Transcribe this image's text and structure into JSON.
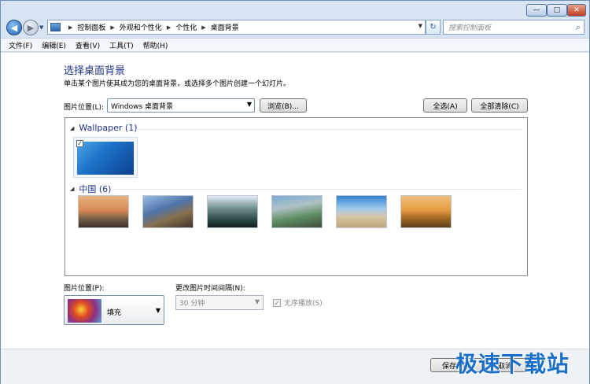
{
  "window": {
    "minimize": "—",
    "maximize": "□",
    "close": "✕"
  },
  "nav": {
    "back_icon": "arrow-left-icon",
    "forward_icon": "arrow-right-icon",
    "breadcrumbs": [
      "控制面板",
      "外观和个性化",
      "个性化",
      "桌面背景"
    ],
    "search_placeholder": "搜索控制面板"
  },
  "menu": [
    "文件(F)",
    "编辑(E)",
    "查看(V)",
    "工具(T)",
    "帮助(H)"
  ],
  "page": {
    "title": "选择桌面背景",
    "description": "单击某个图片使其成为您的桌面背景，或选择多个图片创建一个幻灯片。",
    "location_label": "图片位置(L):",
    "location_value": "Windows 桌面背景",
    "browse": "浏览(B)...",
    "select_all": "全选(A)",
    "clear_all": "全部清除(C)"
  },
  "gallery": {
    "groups": [
      {
        "name": "Wallpaper (1)",
        "checked": true
      },
      {
        "name": "中国 (6)"
      }
    ]
  },
  "options": {
    "position_label": "图片位置(P):",
    "position_value": "填充",
    "interval_label": "更改图片时间间隔(N):",
    "interval_value": "30 分钟",
    "shuffle_label": "无序播放(S)"
  },
  "footer": {
    "save": "保存修改",
    "cancel": "取消"
  },
  "watermark": "极速下载站"
}
